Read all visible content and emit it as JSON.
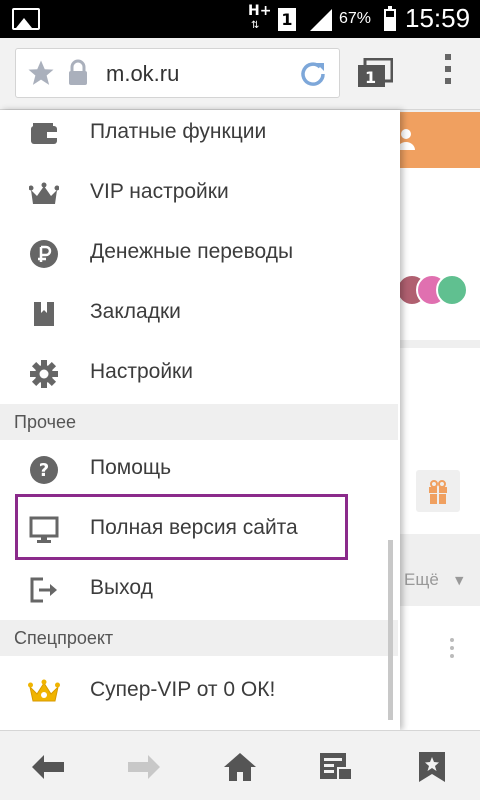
{
  "status_bar": {
    "network": "H+",
    "network_arrows": "⇅",
    "sim": "1",
    "battery": "67%",
    "battery_level": 0.67,
    "time": "15:59"
  },
  "browser": {
    "url": "m.ok.ru",
    "tab_count": "1"
  },
  "menu": {
    "items_top": [
      {
        "label": "Платные функции",
        "icon": "wallet-icon"
      },
      {
        "label": "VIP настройки",
        "icon": "crown-icon"
      },
      {
        "label": "Денежные переводы",
        "icon": "ruble-icon"
      },
      {
        "label": "Закладки",
        "icon": "bookmark-icon"
      },
      {
        "label": "Настройки",
        "icon": "gear-icon"
      }
    ],
    "section_other": "Прочее",
    "items_other": [
      {
        "label": "Помощь",
        "icon": "help-icon"
      },
      {
        "label": "Полная версия сайта",
        "icon": "desktop-icon"
      },
      {
        "label": "Выход",
        "icon": "logout-icon"
      }
    ],
    "section_special": "Спецпроект",
    "items_special": [
      {
        "label": "Супер-VIP от 0 ОК!",
        "icon": "gold-crown-icon"
      }
    ]
  },
  "background_page": {
    "more_label": "Ещё",
    "more_caret": "▼"
  },
  "colors": {
    "accent_orange": "#f0a060",
    "highlight_border": "#8b2a8b",
    "crown_gold": "#f0b400",
    "icon_gray": "#666666"
  }
}
